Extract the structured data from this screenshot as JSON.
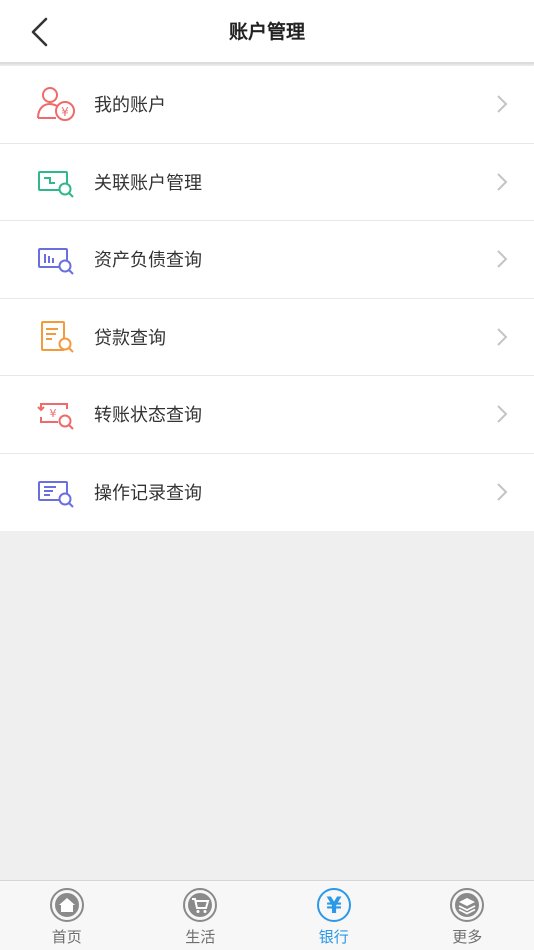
{
  "header": {
    "title": "账户管理",
    "back_icon": "chevron-left-icon"
  },
  "menu": {
    "items": [
      {
        "label": "我的账户",
        "icon": "user-yuan-icon",
        "color": "#f06a6a"
      },
      {
        "label": "关联账户管理",
        "icon": "linked-card-search-icon",
        "color": "#2fb88a"
      },
      {
        "label": "资产负债查询",
        "icon": "chart-search-icon",
        "color": "#6a6fe0"
      },
      {
        "label": "贷款查询",
        "icon": "document-search-icon",
        "color": "#f39a3c"
      },
      {
        "label": "转账状态查询",
        "icon": "transfer-search-icon",
        "color": "#f06a6a"
      },
      {
        "label": "操作记录查询",
        "icon": "record-search-icon",
        "color": "#6a6fe0"
      }
    ]
  },
  "tabbar": {
    "active_color": "#2b98e8",
    "inactive_color": "#8a8a8a",
    "tabs": [
      {
        "label": "首页",
        "icon": "home-icon",
        "active": false
      },
      {
        "label": "生活",
        "icon": "cart-icon",
        "active": false
      },
      {
        "label": "银行",
        "icon": "yuan-icon",
        "active": true
      },
      {
        "label": "更多",
        "icon": "layers-icon",
        "active": false
      }
    ]
  }
}
